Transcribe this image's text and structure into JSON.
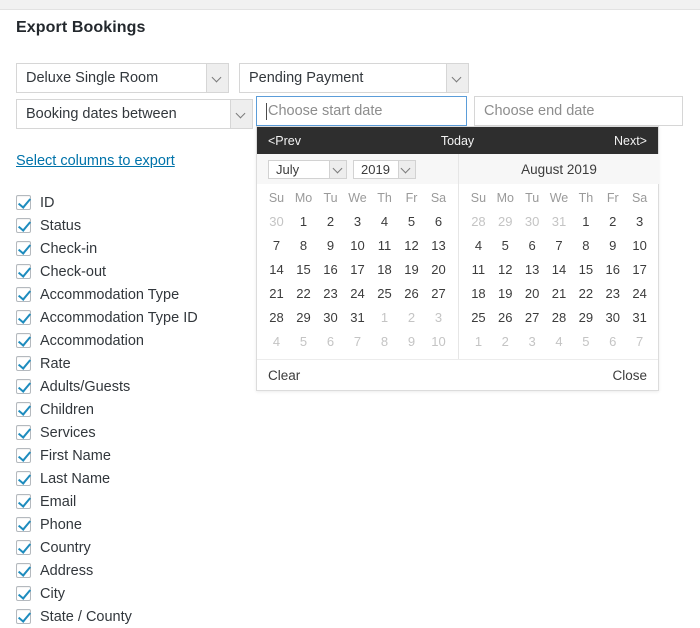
{
  "page_title": "Export Bookings",
  "filters": {
    "accommodation": {
      "value": "Deluxe Single Room"
    },
    "status": {
      "value": "Pending Payment"
    },
    "date_range_type": {
      "value": "Booking dates between"
    },
    "start_date": {
      "placeholder": "Choose start date",
      "value": ""
    },
    "end_date": {
      "placeholder": "Choose end date",
      "value": ""
    }
  },
  "columns_link": "Select columns to export",
  "columns": [
    {
      "label": "ID",
      "checked": true
    },
    {
      "label": "Status",
      "checked": true
    },
    {
      "label": "Check-in",
      "checked": true
    },
    {
      "label": "Check-out",
      "checked": true
    },
    {
      "label": "Accommodation Type",
      "checked": true
    },
    {
      "label": "Accommodation Type ID",
      "checked": true
    },
    {
      "label": "Accommodation",
      "checked": true
    },
    {
      "label": "Rate",
      "checked": true
    },
    {
      "label": "Adults/Guests",
      "checked": true
    },
    {
      "label": "Children",
      "checked": true
    },
    {
      "label": "Services",
      "checked": true
    },
    {
      "label": "First Name",
      "checked": true
    },
    {
      "label": "Last Name",
      "checked": true
    },
    {
      "label": "Email",
      "checked": true
    },
    {
      "label": "Phone",
      "checked": true
    },
    {
      "label": "Country",
      "checked": true
    },
    {
      "label": "Address",
      "checked": true
    },
    {
      "label": "City",
      "checked": true
    },
    {
      "label": "State / County",
      "checked": true
    }
  ],
  "datepicker": {
    "nav": {
      "prev": "<Prev",
      "today": "Today",
      "next": "Next>"
    },
    "footer": {
      "clear": "Clear",
      "close": "Close"
    },
    "dow": [
      "Su",
      "Mo",
      "Tu",
      "We",
      "Th",
      "Fr",
      "Sa"
    ],
    "left_month": {
      "month_value": "July",
      "year_value": "2019",
      "weeks": [
        [
          {
            "d": "30",
            "o": true
          },
          {
            "d": "1"
          },
          {
            "d": "2"
          },
          {
            "d": "3"
          },
          {
            "d": "4"
          },
          {
            "d": "5"
          },
          {
            "d": "6"
          }
        ],
        [
          {
            "d": "7"
          },
          {
            "d": "8"
          },
          {
            "d": "9"
          },
          {
            "d": "10"
          },
          {
            "d": "11"
          },
          {
            "d": "12"
          },
          {
            "d": "13"
          }
        ],
        [
          {
            "d": "14"
          },
          {
            "d": "15"
          },
          {
            "d": "16"
          },
          {
            "d": "17"
          },
          {
            "d": "18"
          },
          {
            "d": "19"
          },
          {
            "d": "20"
          }
        ],
        [
          {
            "d": "21"
          },
          {
            "d": "22"
          },
          {
            "d": "23"
          },
          {
            "d": "24"
          },
          {
            "d": "25"
          },
          {
            "d": "26"
          },
          {
            "d": "27"
          }
        ],
        [
          {
            "d": "28"
          },
          {
            "d": "29"
          },
          {
            "d": "30"
          },
          {
            "d": "31"
          },
          {
            "d": "1",
            "o": true
          },
          {
            "d": "2",
            "o": true
          },
          {
            "d": "3",
            "o": true
          }
        ],
        [
          {
            "d": "4",
            "o": true
          },
          {
            "d": "5",
            "o": true
          },
          {
            "d": "6",
            "o": true
          },
          {
            "d": "7",
            "o": true
          },
          {
            "d": "8",
            "o": true
          },
          {
            "d": "9",
            "o": true
          },
          {
            "d": "10",
            "o": true
          }
        ]
      ]
    },
    "right_month": {
      "title": "August 2019",
      "weeks": [
        [
          {
            "d": "28",
            "o": true
          },
          {
            "d": "29",
            "o": true
          },
          {
            "d": "30",
            "o": true
          },
          {
            "d": "31",
            "o": true
          },
          {
            "d": "1"
          },
          {
            "d": "2"
          },
          {
            "d": "3"
          }
        ],
        [
          {
            "d": "4"
          },
          {
            "d": "5"
          },
          {
            "d": "6"
          },
          {
            "d": "7"
          },
          {
            "d": "8"
          },
          {
            "d": "9"
          },
          {
            "d": "10"
          }
        ],
        [
          {
            "d": "11"
          },
          {
            "d": "12"
          },
          {
            "d": "13"
          },
          {
            "d": "14"
          },
          {
            "d": "15"
          },
          {
            "d": "16"
          },
          {
            "d": "17"
          }
        ],
        [
          {
            "d": "18"
          },
          {
            "d": "19"
          },
          {
            "d": "20"
          },
          {
            "d": "21"
          },
          {
            "d": "22"
          },
          {
            "d": "23"
          },
          {
            "d": "24"
          }
        ],
        [
          {
            "d": "25"
          },
          {
            "d": "26"
          },
          {
            "d": "27"
          },
          {
            "d": "28"
          },
          {
            "d": "29"
          },
          {
            "d": "30"
          },
          {
            "d": "31"
          }
        ],
        [
          {
            "d": "1",
            "o": true
          },
          {
            "d": "2",
            "o": true
          },
          {
            "d": "3",
            "o": true
          },
          {
            "d": "4",
            "o": true
          },
          {
            "d": "5",
            "o": true
          },
          {
            "d": "6",
            "o": true
          },
          {
            "d": "7",
            "o": true
          }
        ]
      ]
    }
  },
  "colors": {
    "link": "#0073aa",
    "nav_bar": "#2e2e2e",
    "checkmark": "#1e8cbe",
    "focus_border": "#5b9dd9"
  }
}
